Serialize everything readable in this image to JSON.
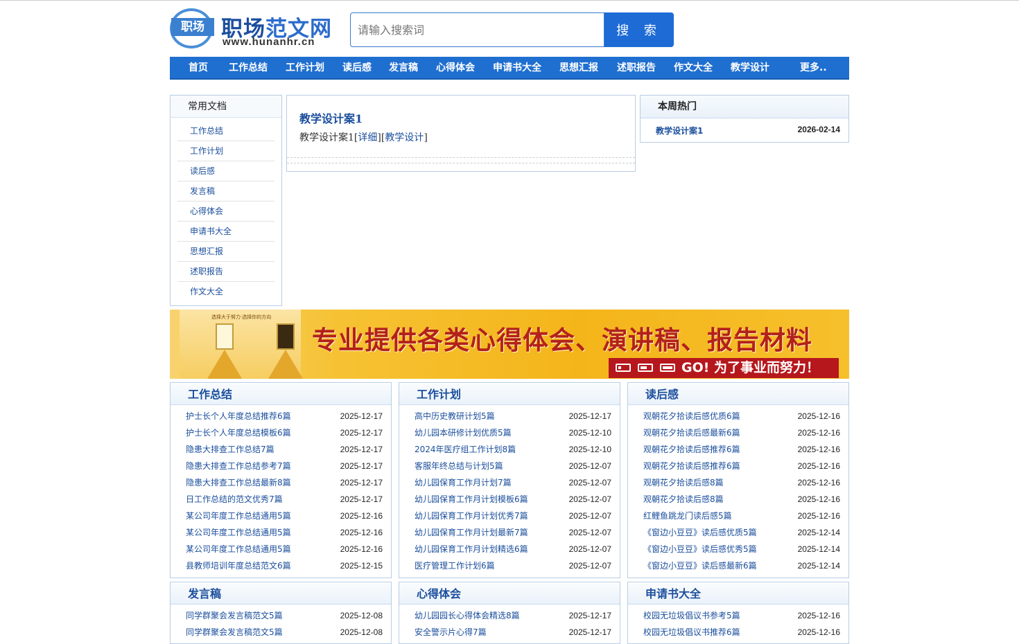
{
  "site": {
    "logo_badge": "职场",
    "logo_title_a": "职场",
    "logo_title_b": "范文网",
    "logo_url": "www.hunanhr.cn"
  },
  "search": {
    "placeholder": "请输入搜索词",
    "button": "搜 索"
  },
  "nav": [
    "首页",
    "工作总结",
    "工作计划",
    "读后感",
    "发言稿",
    "心得体会",
    "申请书大全",
    "思想汇报",
    "述职报告",
    "作文大全",
    "教学设计",
    "更多.."
  ],
  "sidebar": {
    "title": "常用文档",
    "items": [
      "工作总结",
      "工作计划",
      "读后感",
      "发言稿",
      "心得体会",
      "申请书大全",
      "思想汇报",
      "述职报告",
      "作文大全"
    ]
  },
  "article": {
    "title": "教学设计案1",
    "desc_prefix": "教学设计案1[",
    "detail_link": "详细",
    "mid": "][",
    "category_link": "教学设计",
    "suffix": "]"
  },
  "hot": {
    "title": "本周热门",
    "items": [
      {
        "title": "教学设计案1",
        "date": "2026-02-14"
      }
    ]
  },
  "banner": {
    "small": "选择大于努力·选择你的方向",
    "headline": "专业提供各类心得体会、演讲稿、报告材料",
    "go": "GO! 为了事业而努力！"
  },
  "categories": [
    {
      "title": "工作总结",
      "items": [
        {
          "t": "护士长个人年度总结推荐6篇",
          "d": "2025-12-17"
        },
        {
          "t": "护士长个人年度总结模板6篇",
          "d": "2025-12-17"
        },
        {
          "t": "隐患大排查工作总结7篇",
          "d": "2025-12-17"
        },
        {
          "t": "隐患大排查工作总结参考7篇",
          "d": "2025-12-17"
        },
        {
          "t": "隐患大排查工作总结最新8篇",
          "d": "2025-12-17"
        },
        {
          "t": "日工作总结的范文优秀7篇",
          "d": "2025-12-17"
        },
        {
          "t": "某公司年度工作总结通用5篇",
          "d": "2025-12-16"
        },
        {
          "t": "某公司年度工作总结通用5篇",
          "d": "2025-12-16"
        },
        {
          "t": "某公司年度工作总结通用5篇",
          "d": "2025-12-16"
        },
        {
          "t": "县教师培训年度总结范文6篇",
          "d": "2025-12-15"
        }
      ]
    },
    {
      "title": "工作计划",
      "items": [
        {
          "t": "高中历史教研计划5篇",
          "d": "2025-12-17"
        },
        {
          "t": "幼儿园本研修计划优质5篇",
          "d": "2025-12-10"
        },
        {
          "t": "2024年医疗组工作计划8篇",
          "d": "2025-12-10"
        },
        {
          "t": "客服年终总结与计划5篇",
          "d": "2025-12-07"
        },
        {
          "t": "幼儿园保育工作月计划7篇",
          "d": "2025-12-07"
        },
        {
          "t": "幼儿园保育工作月计划模板6篇",
          "d": "2025-12-07"
        },
        {
          "t": "幼儿园保育工作月计划优秀7篇",
          "d": "2025-12-07"
        },
        {
          "t": "幼儿园保育工作月计划最新7篇",
          "d": "2025-12-07"
        },
        {
          "t": "幼儿园保育工作月计划精选6篇",
          "d": "2025-12-07"
        },
        {
          "t": "医疗管理工作计划6篇",
          "d": "2025-12-07"
        }
      ]
    },
    {
      "title": "读后感",
      "items": [
        {
          "t": "观朝花夕拾读后感优质6篇",
          "d": "2025-12-16"
        },
        {
          "t": "观朝花夕拾读后感最新6篇",
          "d": "2025-12-16"
        },
        {
          "t": "观朝花夕拾读后感推荐6篇",
          "d": "2025-12-16"
        },
        {
          "t": "观朝花夕拾读后感推荐6篇",
          "d": "2025-12-16"
        },
        {
          "t": "观朝花夕拾读后感8篇",
          "d": "2025-12-16"
        },
        {
          "t": "观朝花夕拾读后感8篇",
          "d": "2025-12-16"
        },
        {
          "t": "红鲤鱼跳龙门读后感5篇",
          "d": "2025-12-16"
        },
        {
          "t": "《窗边小豆豆》读后感优质5篇",
          "d": "2025-12-14"
        },
        {
          "t": "《窗边小豆豆》读后感优秀5篇",
          "d": "2025-12-14"
        },
        {
          "t": "《窗边小豆豆》读后感最新6篇",
          "d": "2025-12-14"
        }
      ]
    },
    {
      "title": "发言稿",
      "items": [
        {
          "t": "同学群聚会发言稿范文5篇",
          "d": "2025-12-08"
        },
        {
          "t": "同学群聚会发言稿范文5篇",
          "d": "2025-12-08"
        }
      ]
    },
    {
      "title": "心得体会",
      "items": [
        {
          "t": "幼儿园园长心得体会精选8篇",
          "d": "2025-12-17"
        },
        {
          "t": "安全警示片心得7篇",
          "d": "2025-12-17"
        }
      ]
    },
    {
      "title": "申请书大全",
      "items": [
        {
          "t": "校园无垃圾倡议书参考5篇",
          "d": "2025-12-16"
        },
        {
          "t": "校园无垃圾倡议书推荐6篇",
          "d": "2025-12-16"
        }
      ]
    }
  ],
  "colors": {
    "brand": "#1f6fd0",
    "link": "#1a4e9c",
    "banner_red": "#b3211a"
  }
}
